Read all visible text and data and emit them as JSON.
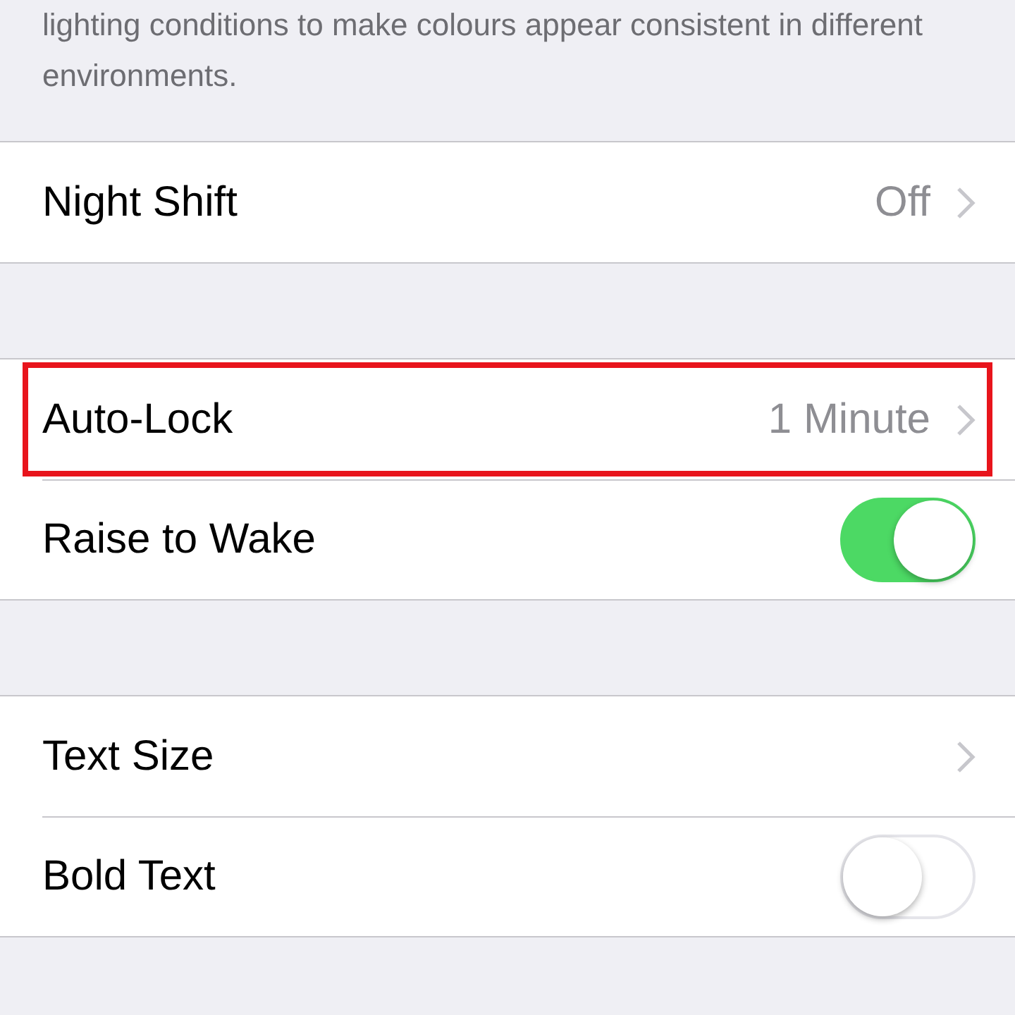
{
  "description": "lighting conditions to make colours appear consistent in different environments.",
  "groups": [
    {
      "rows": [
        {
          "kind": "link",
          "label": "Night Shift",
          "value": "Off",
          "highlighted": false
        }
      ]
    },
    {
      "rows": [
        {
          "kind": "link",
          "label": "Auto-Lock",
          "value": "1 Minute",
          "highlighted": true
        },
        {
          "kind": "toggle",
          "label": "Raise to Wake",
          "on": true,
          "highlighted": false
        }
      ]
    },
    {
      "rows": [
        {
          "kind": "link",
          "label": "Text Size",
          "highlighted": false
        },
        {
          "kind": "toggle",
          "label": "Bold Text",
          "on": false,
          "highlighted": false
        }
      ]
    }
  ]
}
